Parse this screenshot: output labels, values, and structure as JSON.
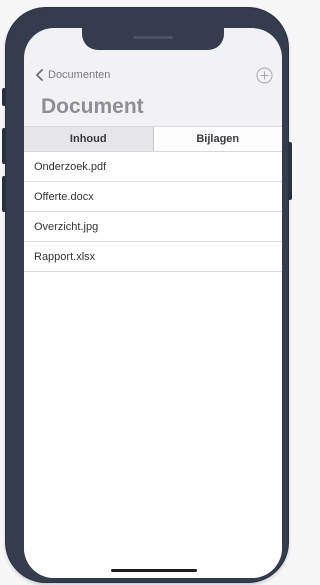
{
  "nav": {
    "back_label": "Documenten"
  },
  "page": {
    "title": "Document"
  },
  "tabs": [
    {
      "label": "Inhoud",
      "active": true
    },
    {
      "label": "Bijlagen",
      "active": false
    }
  ],
  "files": [
    {
      "name": "Onderzoek.pdf"
    },
    {
      "name": "Offerte.docx"
    },
    {
      "name": "Overzicht.jpg"
    },
    {
      "name": "Rapport.xlsx"
    }
  ],
  "icons": {
    "back": "chevron-left-icon",
    "add": "plus-circle-icon"
  },
  "colors": {
    "frame": "#343d4e",
    "screen": "#f2f2f4",
    "active_tab": "#e6e6ea"
  }
}
